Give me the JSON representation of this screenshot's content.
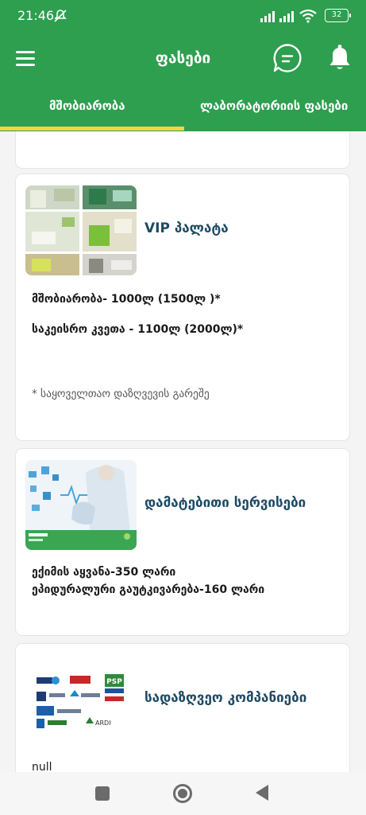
{
  "status_bar": {
    "time": "21:46",
    "battery": "32"
  },
  "header": {
    "title": "ფასები"
  },
  "tabs": [
    {
      "label": "მშობიარობა",
      "active": true
    },
    {
      "label": "ლაბორატორიის ფასები",
      "active": false
    }
  ],
  "cards": {
    "vip": {
      "title": "VIP პალატა",
      "lines": [
        "მშობიარობა- 1000ლ (1500ლ )*",
        "საკეისრო კვეთა - 1100ლ (2000ლ)*"
      ],
      "note": "* საყოველთაო დაზღვევის გარეშე"
    },
    "services": {
      "title": "დამატებითი სერვისები",
      "lines": [
        "ექიმის აყვანა-350 ლარი",
        "ეპიდურალური გაუტკივარება-160 ლარი"
      ]
    },
    "insurance": {
      "title": "სადაზღვეო კომპანიები",
      "text": "null",
      "logos": {
        "ardi": "ARDI",
        "psp": "PSP"
      }
    }
  },
  "colors": {
    "primary": "#2e9e4f",
    "tab_indicator": "#f4d443",
    "card_title": "#1e4a64"
  }
}
